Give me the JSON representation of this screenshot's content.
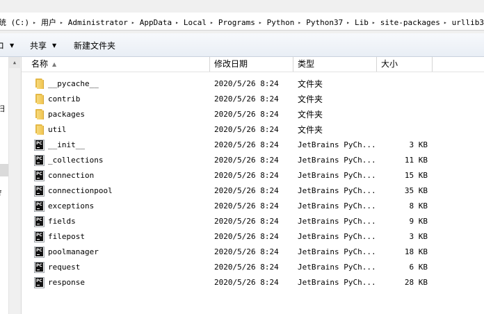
{
  "address_bar": {
    "segments": [
      "统 (C:)",
      "用户",
      "Administrator",
      "AppData",
      "Local",
      "Programs",
      "Python",
      "Python37",
      "Lib",
      "site-packages",
      "urllib3"
    ]
  },
  "toolbar": {
    "item0": "ロ",
    "share_label": "共享",
    "new_folder_label": "新建文件夹"
  },
  "nav_pane": {
    "fragments": [
      "扫",
      "f",
      "）"
    ]
  },
  "columns": {
    "name": "名称",
    "date": "修改日期",
    "type": "类型",
    "size": "大小"
  },
  "files": [
    {
      "name": "__pycache__",
      "date": "2020/5/26 8:24",
      "type": "文件夹",
      "size": "",
      "icon": "folder-icon"
    },
    {
      "name": "contrib",
      "date": "2020/5/26 8:24",
      "type": "文件夹",
      "size": "",
      "icon": "folder-icon"
    },
    {
      "name": "packages",
      "date": "2020/5/26 8:24",
      "type": "文件夹",
      "size": "",
      "icon": "folder-icon"
    },
    {
      "name": "util",
      "date": "2020/5/26 8:24",
      "type": "文件夹",
      "size": "",
      "icon": "folder-icon"
    },
    {
      "name": "__init__",
      "date": "2020/5/26 8:24",
      "type": "JetBrains PyCh...",
      "size": "3 KB",
      "icon": "pycharm-file-icon"
    },
    {
      "name": "_collections",
      "date": "2020/5/26 8:24",
      "type": "JetBrains PyCh...",
      "size": "11 KB",
      "icon": "pycharm-file-icon"
    },
    {
      "name": "connection",
      "date": "2020/5/26 8:24",
      "type": "JetBrains PyCh...",
      "size": "15 KB",
      "icon": "pycharm-file-icon"
    },
    {
      "name": "connectionpool",
      "date": "2020/5/26 8:24",
      "type": "JetBrains PyCh...",
      "size": "35 KB",
      "icon": "pycharm-file-icon"
    },
    {
      "name": "exceptions",
      "date": "2020/5/26 8:24",
      "type": "JetBrains PyCh...",
      "size": "8 KB",
      "icon": "pycharm-file-icon"
    },
    {
      "name": "fields",
      "date": "2020/5/26 8:24",
      "type": "JetBrains PyCh...",
      "size": "9 KB",
      "icon": "pycharm-file-icon"
    },
    {
      "name": "filepost",
      "date": "2020/5/26 8:24",
      "type": "JetBrains PyCh...",
      "size": "3 KB",
      "icon": "pycharm-file-icon"
    },
    {
      "name": "poolmanager",
      "date": "2020/5/26 8:24",
      "type": "JetBrains PyCh...",
      "size": "18 KB",
      "icon": "pycharm-file-icon"
    },
    {
      "name": "request",
      "date": "2020/5/26 8:24",
      "type": "JetBrains PyCh...",
      "size": "6 KB",
      "icon": "pycharm-file-icon"
    },
    {
      "name": "response",
      "date": "2020/5/26 8:24",
      "type": "JetBrains PyCh...",
      "size": "28 KB",
      "icon": "pycharm-file-icon"
    }
  ]
}
